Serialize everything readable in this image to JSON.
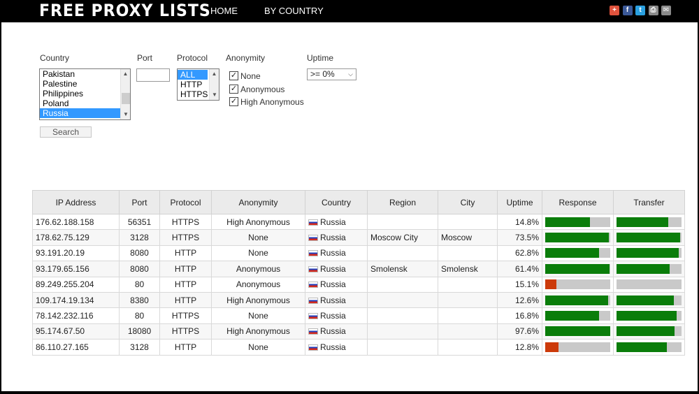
{
  "header": {
    "logo": "FREE PROXY LISTS",
    "nav": {
      "home": "HOME",
      "by_country": "BY COUNTRY"
    },
    "social": [
      {
        "icon": "plus-icon",
        "glyph": "+",
        "color": "#e0533d"
      },
      {
        "icon": "facebook-icon",
        "glyph": "f",
        "color": "#3b5998"
      },
      {
        "icon": "twitter-icon",
        "glyph": "t",
        "color": "#2aa0e0"
      },
      {
        "icon": "print-icon",
        "glyph": "⎙",
        "color": "#8a8a8a"
      },
      {
        "icon": "email-icon",
        "glyph": "✉",
        "color": "#8a8a8a"
      }
    ]
  },
  "filters": {
    "country": {
      "label": "Country",
      "options": [
        "Pakistan",
        "Palestine",
        "Philippines",
        "Poland",
        "Russia"
      ],
      "selected": "Russia"
    },
    "port": {
      "label": "Port",
      "value": ""
    },
    "protocol": {
      "label": "Protocol",
      "options": [
        "ALL",
        "HTTP",
        "HTTPS"
      ],
      "selected": "ALL"
    },
    "anonymity": {
      "label": "Anonymity",
      "options": [
        {
          "label": "None",
          "checked": true
        },
        {
          "label": "Anonymous",
          "checked": true
        },
        {
          "label": "High Anonymous",
          "checked": true
        }
      ]
    },
    "uptime": {
      "label": "Uptime",
      "value": ">= 0%"
    },
    "search_label": "Search"
  },
  "table": {
    "columns": [
      "IP Address",
      "Port",
      "Protocol",
      "Anonymity",
      "Country",
      "Region",
      "City",
      "Uptime",
      "Response",
      "Transfer"
    ],
    "colors": {
      "good": "#0a7d0a",
      "bad": "#cc3a0a",
      "track": "#c9c9c9"
    },
    "rows": [
      {
        "ip": "176.62.188.158",
        "port": "56351",
        "protocol": "HTTPS",
        "anonymity": "High Anonymous",
        "country": "Russia",
        "region": "",
        "city": "",
        "uptime": "14.8%",
        "response": 0.69,
        "response_status": "good",
        "transfer": 0.8
      },
      {
        "ip": "178.62.75.129",
        "port": "3128",
        "protocol": "HTTPS",
        "anonymity": "None",
        "country": "Russia",
        "region": "Moscow City",
        "city": "Moscow",
        "uptime": "73.5%",
        "response": 0.98,
        "response_status": "good",
        "transfer": 0.98
      },
      {
        "ip": "93.191.20.19",
        "port": "8080",
        "protocol": "HTTP",
        "anonymity": "None",
        "country": "Russia",
        "region": "",
        "city": "",
        "uptime": "62.8%",
        "response": 0.83,
        "response_status": "good",
        "transfer": 0.96
      },
      {
        "ip": "93.179.65.156",
        "port": "8080",
        "protocol": "HTTP",
        "anonymity": "Anonymous",
        "country": "Russia",
        "region": "Smolensk",
        "city": "Smolensk",
        "uptime": "61.4%",
        "response": 0.99,
        "response_status": "good",
        "transfer": 0.82
      },
      {
        "ip": "89.249.255.204",
        "port": "80",
        "protocol": "HTTP",
        "anonymity": "Anonymous",
        "country": "Russia",
        "region": "",
        "city": "",
        "uptime": "15.1%",
        "response": 0.17,
        "response_status": "bad",
        "transfer": 0.0
      },
      {
        "ip": "109.174.19.134",
        "port": "8380",
        "protocol": "HTTP",
        "anonymity": "High Anonymous",
        "country": "Russia",
        "region": "",
        "city": "",
        "uptime": "12.6%",
        "response": 0.97,
        "response_status": "good",
        "transfer": 0.88
      },
      {
        "ip": "78.142.232.116",
        "port": "80",
        "protocol": "HTTPS",
        "anonymity": "None",
        "country": "Russia",
        "region": "",
        "city": "",
        "uptime": "16.8%",
        "response": 0.83,
        "response_status": "good",
        "transfer": 0.92
      },
      {
        "ip": "95.174.67.50",
        "port": "18080",
        "protocol": "HTTPS",
        "anonymity": "High Anonymous",
        "country": "Russia",
        "region": "",
        "city": "",
        "uptime": "97.6%",
        "response": 1.0,
        "response_status": "good",
        "transfer": 0.89
      },
      {
        "ip": "86.110.27.165",
        "port": "3128",
        "protocol": "HTTP",
        "anonymity": "None",
        "country": "Russia",
        "region": "",
        "city": "",
        "uptime": "12.8%",
        "response": 0.2,
        "response_status": "bad",
        "transfer": 0.77
      }
    ]
  }
}
